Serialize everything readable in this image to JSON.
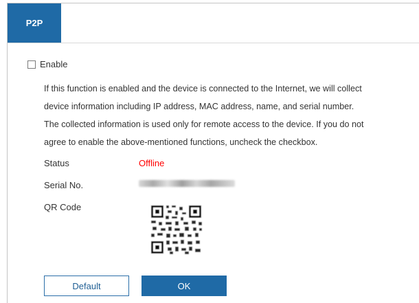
{
  "tabs": [
    {
      "label": "P2P"
    }
  ],
  "enable": {
    "label": "Enable",
    "checked": false
  },
  "description": {
    "lines": [
      "If this function is enabled and the device is connected to the Internet, we will collect",
      "device information including IP address, MAC address, name, and serial number.",
      "The collected information is used only for remote access to the device. If you do not",
      "agree to enable the above-mentioned functions, uncheck the checkbox."
    ]
  },
  "fields": {
    "status_label": "Status",
    "status_value": "Offline",
    "serial_label": "Serial No.",
    "qr_label": "QR Code"
  },
  "buttons": {
    "default_label": "Default",
    "ok_label": "OK"
  },
  "colors": {
    "accent": "#1f6aa6",
    "status_offline": "#ff0000"
  }
}
